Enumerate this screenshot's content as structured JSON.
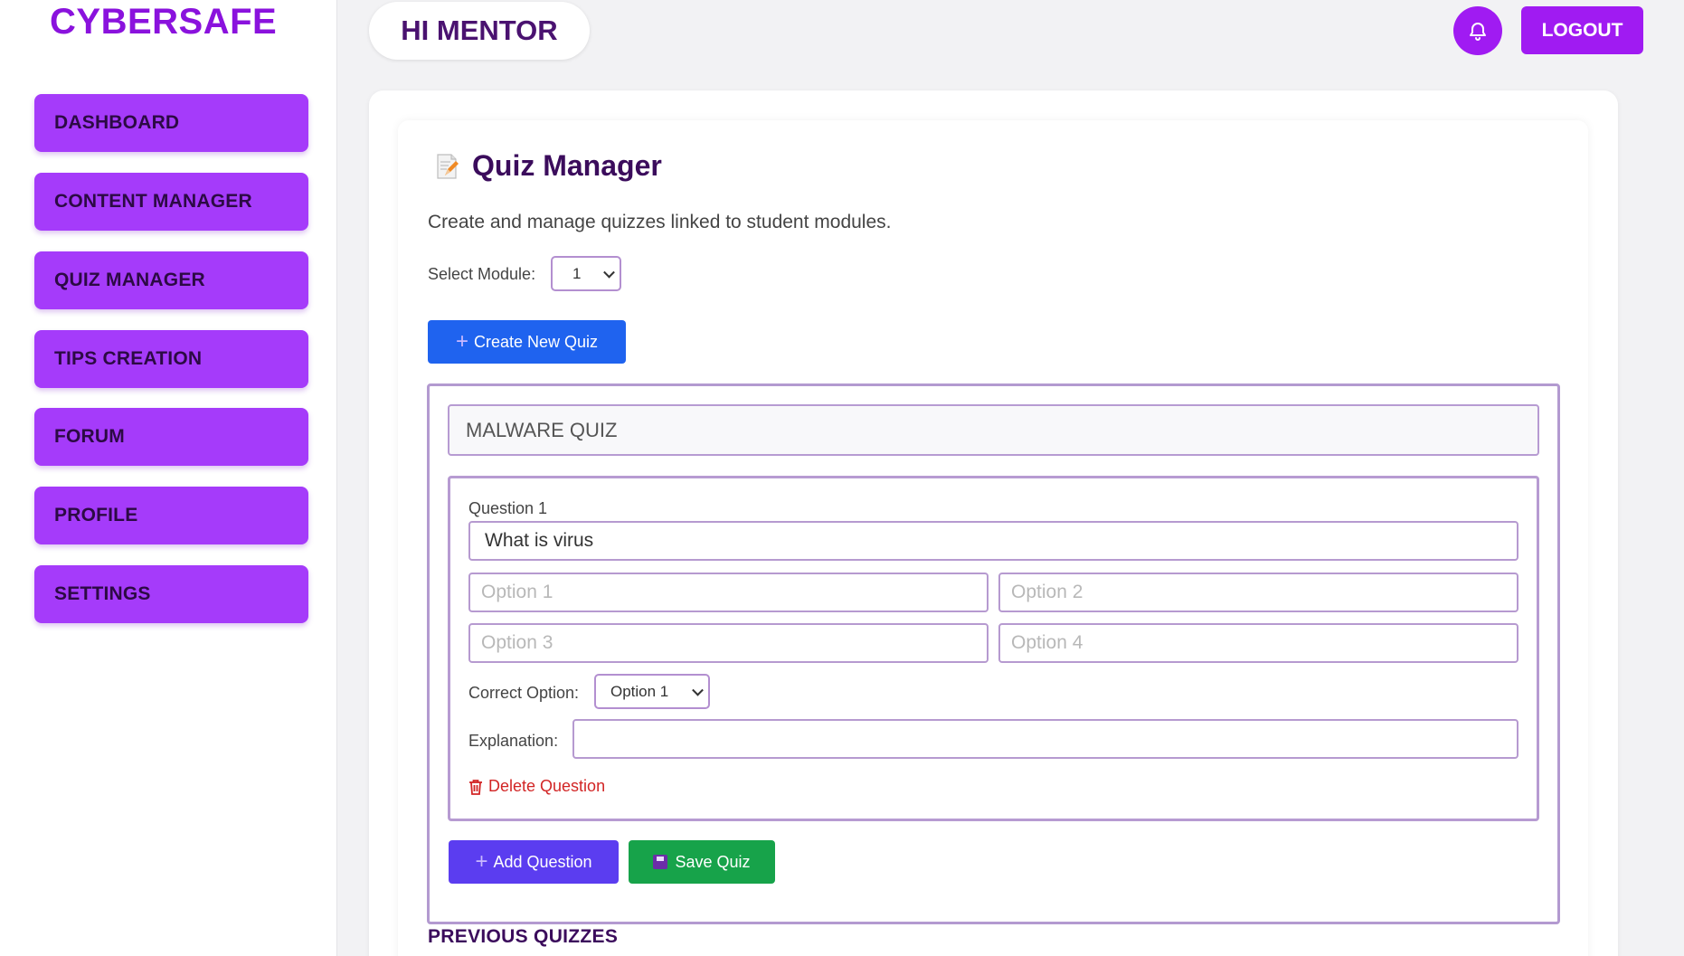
{
  "brand": "CYBERSAFE",
  "sidebar": {
    "items": [
      {
        "label": "DASHBOARD"
      },
      {
        "label": "CONTENT MANAGER"
      },
      {
        "label": "QUIZ MANAGER"
      },
      {
        "label": "TIPS CREATION"
      },
      {
        "label": "FORUM"
      },
      {
        "label": "PROFILE"
      },
      {
        "label": "SETTINGS"
      }
    ]
  },
  "header": {
    "greeting": "HI MENTOR",
    "notification_icon": "bell-icon",
    "logout_label": "LOGOUT"
  },
  "main": {
    "title_icon": "memo-icon",
    "title": "Quiz Manager",
    "subtitle": "Create and manage quizzes linked to student modules.",
    "module_label": "Select Module:",
    "module_value": "1",
    "create_label": "Create New Quiz",
    "quiz": {
      "title_value": "MALWARE QUIZ",
      "question_label": "Question 1",
      "question_value": "What is virus",
      "option_placeholders": [
        "Option 1",
        "Option 2",
        "Option 3",
        "Option 4"
      ],
      "correct_label": "Correct Option:",
      "correct_value": "Option 1",
      "explanation_label": "Explanation:",
      "explanation_value": "",
      "delete_label": "Delete Question"
    },
    "add_question_label": "Add Question",
    "save_quiz_label": "Save Quiz",
    "previous_heading": "PREVIOUS QUIZZES"
  },
  "colors": {
    "accent": "#a01bf2",
    "nav": "#a53bfa",
    "primary_blue": "#1f63ef",
    "add_button": "#5b3df0",
    "save_button": "#17a34a",
    "danger": "#d22525"
  }
}
